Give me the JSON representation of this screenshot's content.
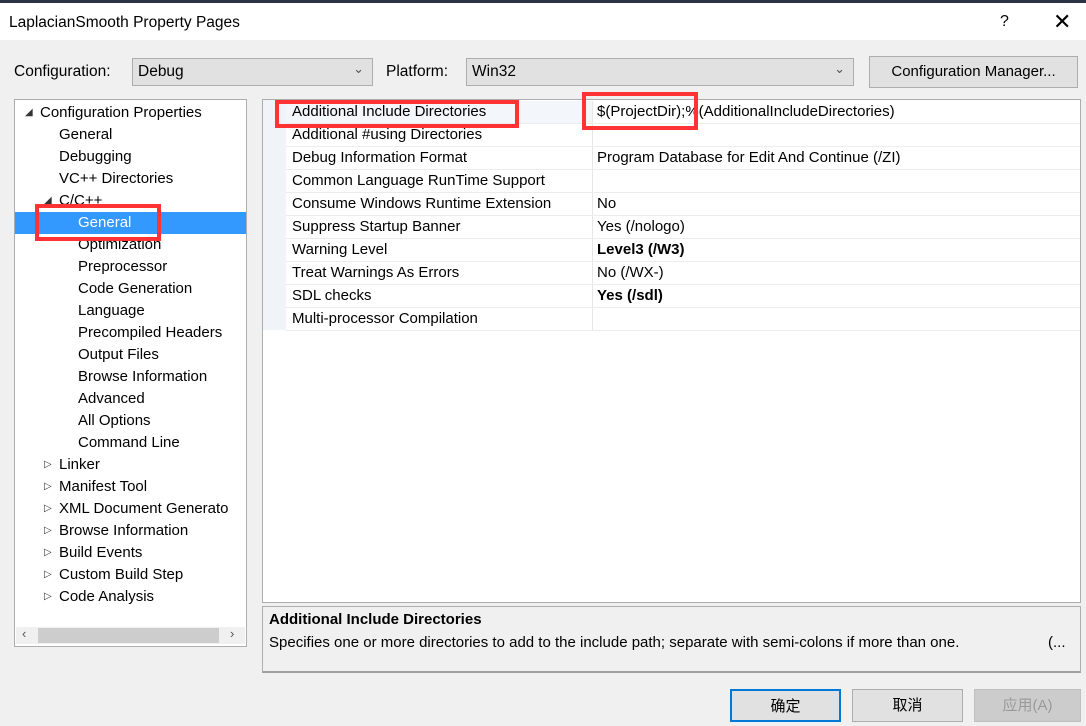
{
  "window": {
    "title": "LaplacianSmooth Property Pages",
    "help": "?",
    "close": "✕"
  },
  "config": {
    "label": "Configuration:",
    "value": "Debug",
    "platform_label": "Platform:",
    "platform_value": "Win32",
    "manager_button": "Configuration Manager..."
  },
  "tree": [
    {
      "label": "Configuration Properties",
      "level": 0,
      "arrow": "expanded"
    },
    {
      "label": "General",
      "level": 1
    },
    {
      "label": "Debugging",
      "level": 1
    },
    {
      "label": "VC++ Directories",
      "level": 1
    },
    {
      "label": "C/C++",
      "level": 1,
      "arrow": "expanded"
    },
    {
      "label": "General",
      "level": 2,
      "selected": true
    },
    {
      "label": "Optimization",
      "level": 2
    },
    {
      "label": "Preprocessor",
      "level": 2
    },
    {
      "label": "Code Generation",
      "level": 2
    },
    {
      "label": "Language",
      "level": 2
    },
    {
      "label": "Precompiled Headers",
      "level": 2
    },
    {
      "label": "Output Files",
      "level": 2
    },
    {
      "label": "Browse Information",
      "level": 2
    },
    {
      "label": "Advanced",
      "level": 2
    },
    {
      "label": "All Options",
      "level": 2
    },
    {
      "label": "Command Line",
      "level": 2
    },
    {
      "label": "Linker",
      "level": 1,
      "arrow": "collapsed"
    },
    {
      "label": "Manifest Tool",
      "level": 1,
      "arrow": "collapsed"
    },
    {
      "label": "XML Document Generato",
      "level": 1,
      "arrow": "collapsed"
    },
    {
      "label": "Browse Information",
      "level": 1,
      "arrow": "collapsed"
    },
    {
      "label": "Build Events",
      "level": 1,
      "arrow": "collapsed"
    },
    {
      "label": "Custom Build Step",
      "level": 1,
      "arrow": "collapsed"
    },
    {
      "label": "Code Analysis",
      "level": 1,
      "arrow": "collapsed"
    }
  ],
  "properties": [
    {
      "name": "Additional Include Directories",
      "value": "$(ProjectDir);%(AdditionalIncludeDirectories)",
      "bold": false
    },
    {
      "name": "Additional #using Directories",
      "value": "",
      "bold": false
    },
    {
      "name": "Debug Information Format",
      "value": "Program Database for Edit And Continue (/ZI)",
      "bold": false
    },
    {
      "name": "Common Language RunTime Support",
      "value": "",
      "bold": false
    },
    {
      "name": "Consume Windows Runtime Extension",
      "value": "No",
      "bold": false
    },
    {
      "name": "Suppress Startup Banner",
      "value": "Yes (/nologo)",
      "bold": false
    },
    {
      "name": "Warning Level",
      "value": "Level3 (/W3)",
      "bold": true
    },
    {
      "name": "Treat Warnings As Errors",
      "value": "No (/WX-)",
      "bold": false
    },
    {
      "name": "SDL checks",
      "value": "Yes (/sdl)",
      "bold": true
    },
    {
      "name": "Multi-processor Compilation",
      "value": "",
      "bold": false
    }
  ],
  "description": {
    "title": "Additional Include Directories",
    "text": "Specifies one or more directories to add to the include path; separate with semi-colons if more than one.",
    "more": "(..."
  },
  "buttons": {
    "ok": "确定",
    "cancel": "取消",
    "apply": "应用(A)"
  },
  "colors": {
    "selection": "#3399ff",
    "highlight_box": "#ff3333",
    "focus_border": "#0078d7"
  }
}
